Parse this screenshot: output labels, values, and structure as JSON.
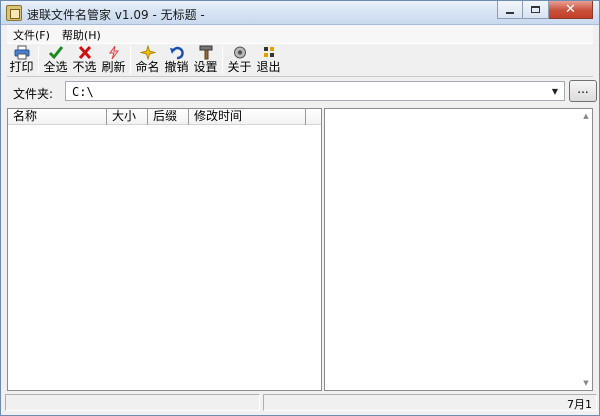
{
  "window": {
    "title": "速联文件名管家 v1.09 - 无标题 - ",
    "minimize_label": "minimize",
    "maximize_label": "maximize",
    "close_label": "close"
  },
  "menu": {
    "items": [
      {
        "label": "文件(F)"
      },
      {
        "label": "帮助(H)"
      }
    ]
  },
  "toolbar": {
    "tools": [
      {
        "label": "打印",
        "icon": "printer-icon",
        "color": "#2a60c0"
      },
      {
        "label": "全选",
        "icon": "checkmark-icon",
        "color": "#1d8a1d"
      },
      {
        "label": "不选",
        "icon": "red-x-icon",
        "color": "#d01010"
      },
      {
        "label": "刷新",
        "icon": "lightning-icon",
        "color": "#e04040"
      },
      {
        "label": "命名",
        "icon": "sparkle-icon",
        "color": "#e0b000"
      },
      {
        "label": "撤销",
        "icon": "undo-icon",
        "color": "#1a4fb0"
      },
      {
        "label": "设置",
        "icon": "hammer-icon",
        "color": "#5a5a5a"
      },
      {
        "label": "关于",
        "icon": "about-icon",
        "color": "#555555"
      },
      {
        "label": "退出",
        "icon": "exit-icon",
        "color": "#333333"
      }
    ]
  },
  "folder": {
    "label": "文件夹:",
    "value": "C:\\",
    "browse_label": "..."
  },
  "file_list": {
    "columns": [
      "名称",
      "大小",
      "后缀",
      "修改时间"
    ]
  },
  "status": {
    "text": "7月1"
  },
  "colors": {
    "title_gradient_top": "#e9f1fb",
    "close_button": "#c9503a",
    "window_bg": "#f0f0f0"
  }
}
